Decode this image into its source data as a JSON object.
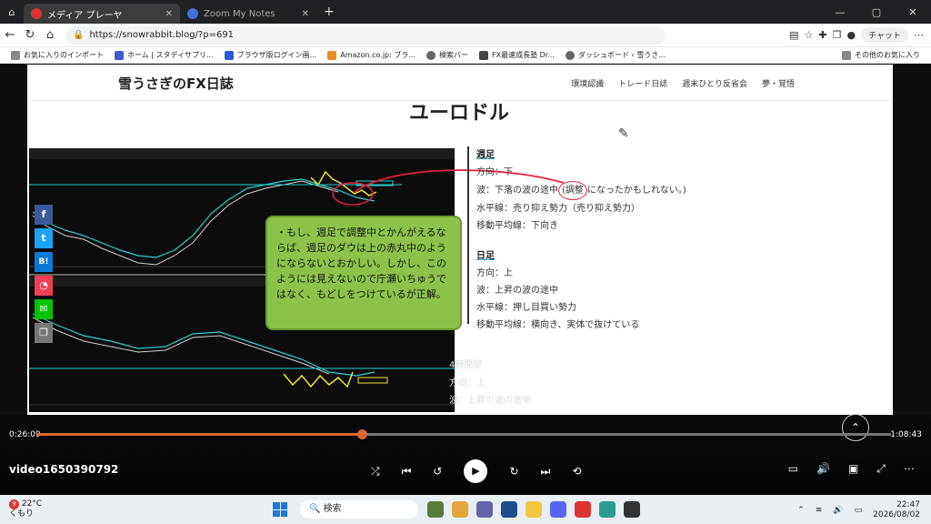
{
  "browser": {
    "tabs": [
      {
        "title": "メディア プレーヤ"
      },
      {
        "title": "Zoom My Notes"
      }
    ],
    "url": "https://snowrabbit.blog/?p=691",
    "chat_label": "チャット",
    "bookmarks": [
      "お気に入りのインポート",
      "ホーム | スタディサプリ...",
      "ブラウザ版ログイン画...",
      "Amazon.co.jp: ブラ...",
      "検索バー",
      "FX最速成長塾 Dr...",
      "ダッシュボード ‹ 雪うさ..."
    ],
    "bookmarks_other": "その他のお気に入り"
  },
  "site": {
    "logo": "雪うさぎのFX日誌",
    "nav": [
      "環境認識",
      "トレード日誌",
      "週末ひとり反省会",
      "夢・覚悟"
    ],
    "page_title": "ユーロドル"
  },
  "callout": {
    "text": "・もし、週足で調整中とかんがえるならば、週足のダウは上の赤丸中のようにならないとおかしい。しかし、このようには見えないので庁瀬いちゅうではなく、もどしをつけているが正解。"
  },
  "analysis": {
    "weekly": {
      "heading": "週足",
      "direction": "方向：下",
      "wave_prefix": "波：下落の波の途中",
      "wave_circled": "(調整",
      "wave_suffix": "になったかもしれない。)",
      "horizontal": "水平線：売り抑え勢力（売り抑え勢力）",
      "ma": "移動平均線：下向き"
    },
    "daily": {
      "heading": "日足",
      "direction": "方向：上",
      "wave": "波：上昇の波の途中",
      "horizontal": "水平線：押し目買い勢力",
      "ma": "移動平均線：横向き、実体で抜けている"
    },
    "h4": {
      "heading": "4時間足",
      "direction": "方向：上",
      "wave": "波：上昇の波の途中"
    }
  },
  "player": {
    "time_current": "0:26:09",
    "time_total": "1:08:43",
    "progress": 0.3806,
    "title": "video1650390792"
  },
  "taskbar": {
    "weather_temp": "22°C",
    "weather_desc": "くもり",
    "notif_count": "9",
    "search_placeholder": "検索",
    "time": "22:47",
    "date": "2026/08/02"
  },
  "colors": {
    "callout_bg": "#8bc34a",
    "accent_red": "#e0223f",
    "seek_fill": "#d9682e"
  }
}
